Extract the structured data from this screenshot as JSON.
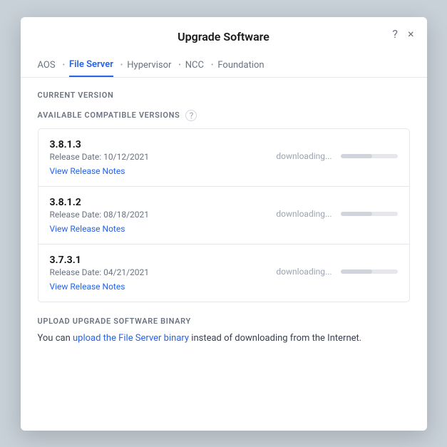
{
  "modal": {
    "title": "Upgrade Software",
    "help_icon": "?",
    "close_icon": "×"
  },
  "tabs": [
    {
      "label": "AOS",
      "active": false
    },
    {
      "label": "File Server",
      "active": true
    },
    {
      "label": "Hypervisor",
      "active": false
    },
    {
      "label": "NCC",
      "active": false
    },
    {
      "label": "Foundation",
      "active": false
    }
  ],
  "sections": {
    "current_version_label": "CURRENT VERSION",
    "available_versions_label": "AVAILABLE COMPATIBLE VERSIONS",
    "upload_label": "UPLOAD UPGRADE SOFTWARE BINARY"
  },
  "versions": [
    {
      "number": "3.8.1.3",
      "release_date": "Release Date: 10/12/2021",
      "link_text": "View Release Notes",
      "status": "downloading...",
      "progress": 55
    },
    {
      "number": "3.8.1.2",
      "release_date": "Release Date: 08/18/2021",
      "link_text": "View Release Notes",
      "status": "downloading...",
      "progress": 55
    },
    {
      "number": "3.7.3.1",
      "release_date": "Release Date: 04/21/2021",
      "link_text": "View Release Notes",
      "status": "downloading...",
      "progress": 55
    }
  ],
  "upload_section": {
    "text_before": "You can ",
    "link_text": "upload the File Server binary",
    "text_after": " instead of downloading from the Internet."
  }
}
